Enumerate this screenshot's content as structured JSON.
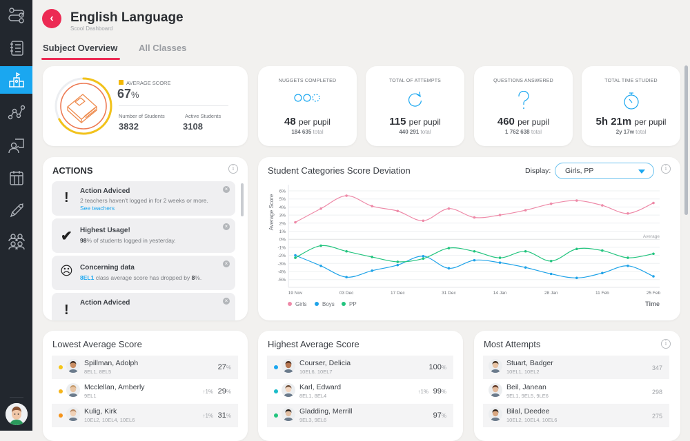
{
  "sidebar": {
    "items": [
      {
        "icon": "workflow-icon",
        "label": "Workflow"
      },
      {
        "icon": "notebook-icon",
        "label": "Notebook"
      },
      {
        "icon": "school-icon",
        "label": "School",
        "active": true
      },
      {
        "icon": "analytics-icon",
        "label": "Analytics"
      },
      {
        "icon": "teacher-icon",
        "label": "Teacher"
      },
      {
        "icon": "calendar-icon",
        "label": "Calendar"
      },
      {
        "icon": "pencil-icon",
        "label": "Edit"
      },
      {
        "icon": "students-icon",
        "label": "Students"
      }
    ]
  },
  "header": {
    "title": "English Language",
    "subtitle": "Scool Dashboard",
    "back_icon": "‹"
  },
  "tabs": [
    {
      "label": "Subject Overview",
      "active": true
    },
    {
      "label": "All Classes",
      "active": false
    }
  ],
  "overview": {
    "avg_label": "AVERAGE SCORE",
    "avg_value": "67",
    "avg_unit": "%",
    "avg_fraction": 0.67,
    "students_label": "Number of Students",
    "students_value": "3832",
    "active_label": "Active Students",
    "active_value": "3108",
    "colors": {
      "ring": "#f2c21b",
      "accent": "#f2b705"
    }
  },
  "stats": [
    {
      "label": "NUGGETS COMPLETED",
      "icon": "nuggets-icon",
      "value": "48",
      "unit": "per pupil",
      "total": "184 635",
      "total_label": "total"
    },
    {
      "label": "TOTAL OF ATTEMPTS",
      "icon": "refresh-icon",
      "value": "115",
      "unit": "per pupil",
      "total": "440 291",
      "total_label": "total"
    },
    {
      "label": "QUESTIONS ANSWERED",
      "icon": "question-icon",
      "value": "460",
      "unit": "per pupil",
      "total": "1 762 638",
      "total_label": "total"
    },
    {
      "label": "TOTAL TIME STUDIED",
      "icon": "stopwatch-icon",
      "value": "5h 21m",
      "unit": "per pupil",
      "total": "2y 17w",
      "total_label": "total"
    }
  ],
  "actions": {
    "title": "ACTIONS",
    "items": [
      {
        "icon": "!",
        "title": "Action Adviced",
        "text": "2 teachers haven't logged in for 2 weeks or more.",
        "link": "See teachers"
      },
      {
        "icon": "✔",
        "title": "Highest Usage!",
        "bold": "98",
        "text": "% of students logged in yesterday."
      },
      {
        "icon": "☹",
        "title": "Concerning data",
        "link": "8EL1",
        "text": " class average score has dropped by ",
        "bold": "8",
        "text2": "%."
      },
      {
        "icon": "!",
        "title": "Action Adviced"
      }
    ]
  },
  "chart_panel": {
    "display_label": "Display:",
    "display_value": "Girls, PP"
  },
  "chart_data": {
    "type": "line",
    "title": "Student Categories Score Deviation",
    "xlabel": "Time",
    "ylabel": "Average Score",
    "ylim": [
      -6,
      6
    ],
    "yticks": [
      "6%",
      "5%",
      "4%",
      "3%",
      "2%",
      "1%",
      "0%",
      "-1%",
      "-2%",
      "-3%",
      "-4%",
      "-5%"
    ],
    "x_tick_labels": [
      "19 Nov",
      "03 Dec",
      "17 Dec",
      "31 Dec",
      "14 Jan",
      "28 Jan",
      "11 Feb",
      "25 Feb"
    ],
    "x": [
      "19 Nov",
      "26 Nov",
      "03 Dec",
      "10 Dec",
      "17 Dec",
      "24 Dec",
      "31 Dec",
      "07 Jan",
      "14 Jan",
      "21 Jan",
      "28 Jan",
      "04 Feb",
      "11 Feb",
      "18 Feb",
      "25 Feb"
    ],
    "annotation": "Average",
    "grid": true,
    "legend": "bottom-left",
    "series": [
      {
        "name": "Girls",
        "color": "#ee8aa8",
        "values": [
          2.1,
          3.8,
          5.4,
          4.1,
          3.5,
          2.3,
          3.8,
          2.7,
          3.0,
          3.6,
          4.4,
          4.8,
          4.2,
          3.2,
          4.5
        ]
      },
      {
        "name": "Boys",
        "color": "#1fa3e8",
        "values": [
          -2.0,
          -3.3,
          -4.7,
          -3.9,
          -3.2,
          -2.1,
          -3.6,
          -2.6,
          -2.9,
          -3.5,
          -4.3,
          -4.8,
          -4.2,
          -3.3,
          -4.6
        ]
      },
      {
        "name": "PP",
        "color": "#22c47e",
        "values": [
          -2.3,
          -0.8,
          -1.5,
          -2.2,
          -2.8,
          -2.4,
          -1.1,
          -1.5,
          -2.3,
          -1.5,
          -2.7,
          -1.2,
          -1.4,
          -2.3,
          -1.8
        ]
      }
    ]
  },
  "lowest": {
    "title": "Lowest Average Score",
    "rows": [
      {
        "name": "Spillman, Adolph",
        "classes": "8EL1, 8EL5",
        "value": "27",
        "delta": "",
        "dot": "#f5c518"
      },
      {
        "name": "Mcclellan, Amberly",
        "classes": "9EL1",
        "value": "29",
        "delta": "↑1%",
        "dot": "#f5b51b"
      },
      {
        "name": "Kulig, Kirk",
        "classes": "10EL2, 10EL4, 10EL6",
        "value": "31",
        "delta": "↑1%",
        "dot": "#f5941b"
      }
    ]
  },
  "highest": {
    "title": "Highest Average Score",
    "rows": [
      {
        "name": "Courser, Delicia",
        "classes": "10EL6, 10EL7",
        "value": "100",
        "delta": "",
        "dot": "#1aa7f0"
      },
      {
        "name": "Karl, Edward",
        "classes": "8EL1, 8EL4",
        "value": "99",
        "delta": "↑1%",
        "dot": "#1bbcc9"
      },
      {
        "name": "Gladding, Merrill",
        "classes": "9EL3, 9EL6",
        "value": "97",
        "delta": "",
        "dot": "#22c47e"
      }
    ]
  },
  "attempts": {
    "title": "Most Attempts",
    "rows": [
      {
        "name": "Stuart, Badger",
        "classes": "10EL1, 10EL2",
        "value": "347"
      },
      {
        "name": "Beil, Janean",
        "classes": "9EL1, 9EL5, 9LE6",
        "value": "298"
      },
      {
        "name": "Bilal, Deedee",
        "classes": "10EL2, 10EL4, 10EL6",
        "value": "275"
      }
    ]
  },
  "common": {
    "pct": "%",
    "info": "i",
    "close": "×"
  }
}
